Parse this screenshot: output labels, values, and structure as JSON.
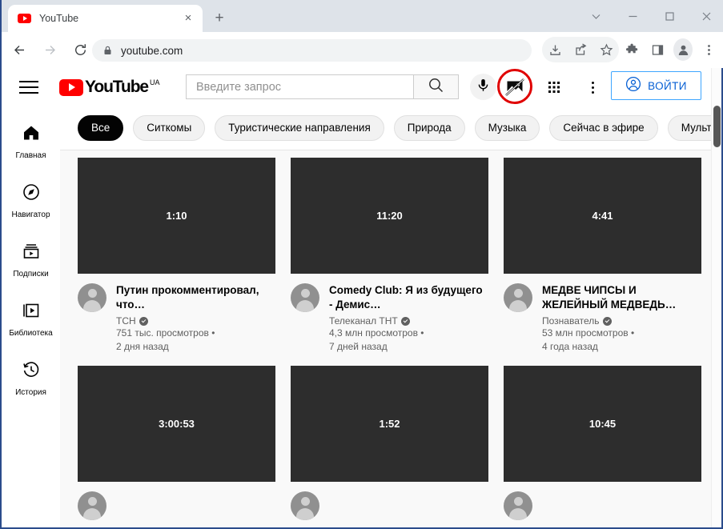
{
  "browser": {
    "tab": {
      "title": "YouTube",
      "favicon": "youtube-icon",
      "close": "×"
    },
    "newtab_label": "+",
    "window_controls": [
      "chevron-down",
      "minimize",
      "maximize",
      "close"
    ],
    "nav": {
      "back": "←",
      "forward": "→",
      "reload": "↻"
    },
    "omnibox": {
      "url": "youtube.com",
      "lock": "lock-icon"
    },
    "toolbar_icons": [
      "download-icon",
      "share-icon",
      "bookmark-star-icon",
      "extensions-puzzle-icon",
      "sidebar-panel-icon",
      "profile-avatar-icon",
      "chrome-menu-icon"
    ]
  },
  "youtube": {
    "logo": {
      "text": "YouTube",
      "superscript": "UA"
    },
    "search": {
      "placeholder": "Введите запрос",
      "value": ""
    },
    "header_icons": {
      "search": "search-icon",
      "voice": "microphone-icon",
      "broken_image": "broken-image-icon",
      "apps": "apps-grid-icon",
      "more": "vertical-dots-icon"
    },
    "signin_label": "ВОЙТИ",
    "annotation": {
      "type": "red-circle-highlight",
      "color": "#e00000",
      "target": "broken-image-icon"
    },
    "sidebar": [
      {
        "label": "Главная",
        "icon": "home-icon",
        "active": true
      },
      {
        "label": "Навигатор",
        "icon": "compass-icon",
        "active": false
      },
      {
        "label": "Подписки",
        "icon": "subscriptions-icon",
        "active": false
      },
      {
        "label": "Библиотека",
        "icon": "library-icon",
        "active": false
      },
      {
        "label": "История",
        "icon": "history-clock-icon",
        "active": false
      }
    ],
    "chips": [
      {
        "label": "Все",
        "active": true
      },
      {
        "label": "Ситкомы",
        "active": false
      },
      {
        "label": "Туристические направления",
        "active": false
      },
      {
        "label": "Природа",
        "active": false
      },
      {
        "label": "Музыка",
        "active": false
      },
      {
        "label": "Сейчас в эфире",
        "active": false
      },
      {
        "label": "Мультф",
        "active": false
      }
    ],
    "videos": [
      {
        "duration": "1:10",
        "title": "Путин прокомментировал, что…",
        "channel": "ТСН",
        "verified": true,
        "views": "751 тыс. просмотров •",
        "age": "2 дня назад"
      },
      {
        "duration": "11:20",
        "title": "Comedy Club: Я из будущего - Демис…",
        "channel": "Телеканал ТНТ",
        "verified": true,
        "views": "4,3 млн просмотров •",
        "age": "7 дней назад"
      },
      {
        "duration": "4:41",
        "title": "МЕДВЕ ЧИПСЫ И ЖЕЛЕЙНЫЙ МЕДВЕДЬ…",
        "channel": "Познаватель",
        "verified": true,
        "views": "53 млн просмотров •",
        "age": "4 года назад"
      },
      {
        "duration": "3:00:53",
        "title": "",
        "channel": "",
        "verified": false,
        "views": "",
        "age": ""
      },
      {
        "duration": "1:52",
        "title": "",
        "channel": "",
        "verified": false,
        "views": "",
        "age": ""
      },
      {
        "duration": "10:45",
        "title": "",
        "channel": "",
        "verified": false,
        "views": "",
        "age": ""
      }
    ]
  }
}
